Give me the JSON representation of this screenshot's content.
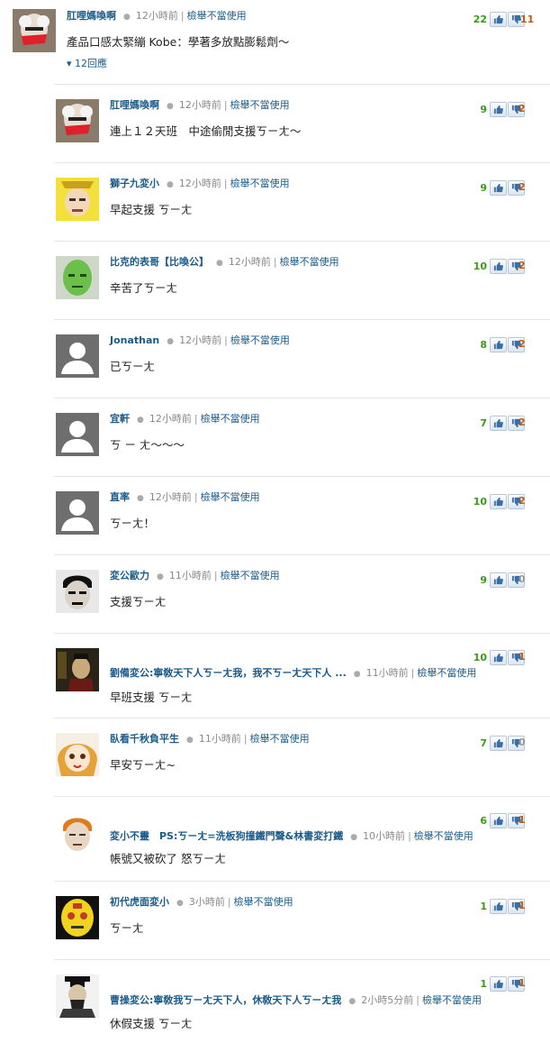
{
  "comments": [
    {
      "name": "肛哩媽喚啊",
      "time": "12小時前",
      "report": "檢舉不當使用",
      "text": "產品口感太緊繃 Kobe：學著多放點膨鬆劑～",
      "up": "22",
      "down": "11",
      "avatar": "cartoon-face-red-mouth",
      "replies": "▾ 12回應"
    },
    {
      "name": "肛哩媽喚啊",
      "time": "12小時前",
      "report": "檢舉不當使用",
      "text": "連上１２天班　中途偷閒支援ㄎㄧㄤ～",
      "up": "9",
      "down": "2",
      "avatar": "cartoon-face-red-mouth"
    },
    {
      "name": "獅子九変小",
      "time": "12小時前",
      "report": "檢舉不當使用",
      "text": "早起支援 ㄎㄧㄤ",
      "up": "9",
      "down": "2",
      "avatar": "yellow-face"
    },
    {
      "name": "比克的表哥【比喚公】",
      "time": "12小時前",
      "report": "檢舉不當使用",
      "text": "辛苦了ㄎㄧㄤ",
      "up": "10",
      "down": "2",
      "avatar": "green-face"
    },
    {
      "name": "Jonathan",
      "time": "12小時前",
      "report": "檢舉不當使用",
      "text": "已ㄎㄧㄤ",
      "up": "8",
      "down": "2",
      "avatar": "default-user"
    },
    {
      "name": "宜軒",
      "time": "12小時前",
      "report": "檢舉不當使用",
      "text": "ㄎ ㄧ ㄤ～～～",
      "up": "7",
      "down": "2",
      "avatar": "default-user"
    },
    {
      "name": "直率",
      "time": "12小時前",
      "report": "檢舉不當使用",
      "text": "ㄎㄧㄤ！",
      "up": "10",
      "down": "2",
      "avatar": "default-user"
    },
    {
      "name": "変公歐力",
      "time": "11小時前",
      "report": "檢舉不當使用",
      "text": "支援ㄎㄧㄤ",
      "up": "9",
      "down": "0",
      "avatar": "bw-face"
    },
    {
      "name": "劉備変公:寧敎天下人ㄎㄧㄤ我，我不ㄎㄧㄤ天下人 ...",
      "time": "11小時前",
      "report": "檢舉不當使用",
      "text": "早班支援 ㄎㄧㄤ",
      "up": "10",
      "down": "1",
      "avatar": "portrait-dark"
    },
    {
      "name": "臥看千秋負平生",
      "time": "11小時前",
      "report": "檢舉不當使用",
      "text": "早安ㄎㄧㄤ~",
      "up": "7",
      "down": "0",
      "avatar": "anime-girl"
    },
    {
      "name": "変小不靈　PS:ㄎㄧㄤ=洗板狗撞鐵門聲&林書変打鐵",
      "time": "10小時前",
      "report": "檢舉不當使用",
      "text": "帳號又被砍了 怒ㄎㄧㄤ",
      "up": "6",
      "down": "1",
      "avatar": "orange-hair-face"
    },
    {
      "name": "初代虎面変小",
      "time": "3小時前",
      "report": "檢舉不當使用",
      "text": "ㄎㄧㄤ",
      "up": "1",
      "down": "1",
      "avatar": "yellow-mask"
    },
    {
      "name": "曹操変公:寧敎我ㄎㄧㄤ天下人，休敎天下人ㄎㄧㄤ我",
      "time": "2小時5分前",
      "report": "檢舉不當使用",
      "text": "休假支援 ㄎㄧㄤ",
      "up": "1",
      "down": "1",
      "avatar": "portrait-hat"
    }
  ]
}
